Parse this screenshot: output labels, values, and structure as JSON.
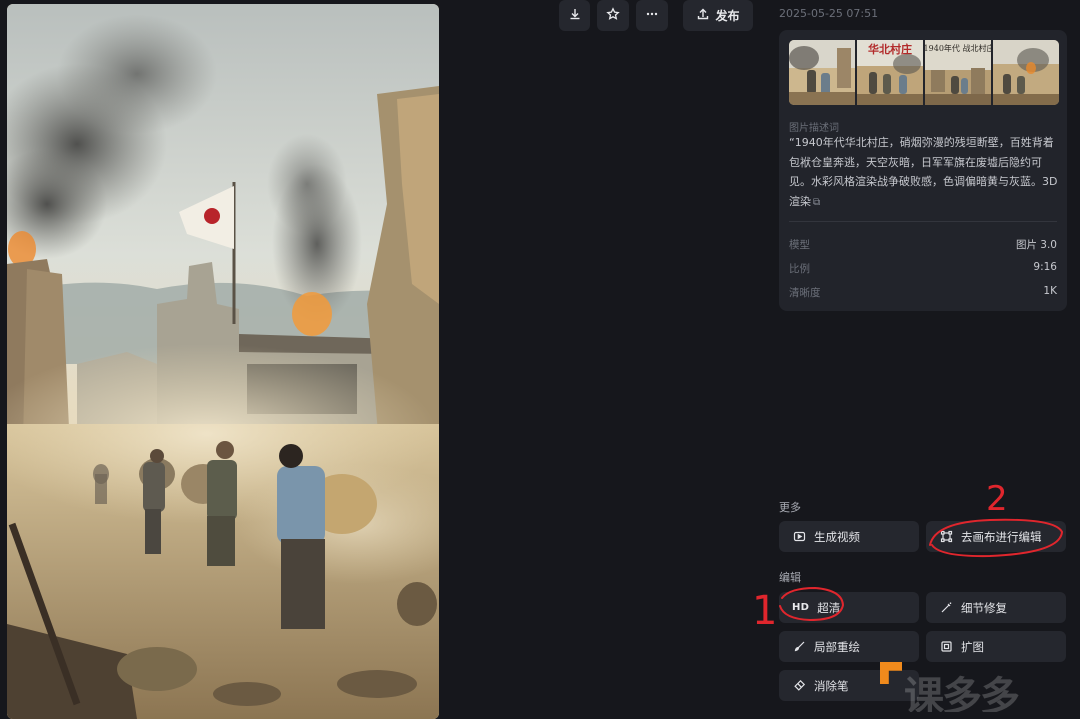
{
  "toolbar": {
    "download_icon": "download-icon",
    "star_icon": "star-icon",
    "more_icon": "more-icon",
    "publish_icon": "upload-icon",
    "publish_label": "发布"
  },
  "meta": {
    "date": "2025-05-25 07:51"
  },
  "thumbnails": [
    {
      "caption": ""
    },
    {
      "caption": "华北村庄"
    },
    {
      "caption": "1940年代 战北村庄"
    },
    {
      "caption": ""
    }
  ],
  "description": {
    "label": "图片描述词",
    "text": "“1940年代华北村庄，硝烟弥漫的残垣断壁，百姓背着包袱仓皇奔逃，天空灰暗，日军军旗在废墟后隐约可见。水彩风格渲染战争破败感，色调偏暗黄与灰蓝。3D渲染",
    "copy_icon": "copy-icon"
  },
  "params": [
    {
      "key": "模型",
      "value": "图片 3.0"
    },
    {
      "key": "比例",
      "value": "9:16"
    },
    {
      "key": "清晰度",
      "value": "1K"
    }
  ],
  "more": {
    "label": "更多",
    "generate_video": "生成视频",
    "canvas_edit": "去画布进行编辑"
  },
  "edit": {
    "label": "编辑",
    "hd_badge": "HD",
    "upscale": "超清",
    "detail_fix": "细节修复",
    "inpaint": "局部重绘",
    "outpaint": "扩图",
    "eraser": "消除笔"
  },
  "annotations": {
    "mark_1": "1",
    "mark_2": "2"
  },
  "watermark": {
    "text": "课多多"
  },
  "colors": {
    "background": "#16171c",
    "card": "#22242b",
    "button": "#25272e",
    "annotation_red": "#e0262d",
    "watermark_orange": "#f08a1c"
  }
}
